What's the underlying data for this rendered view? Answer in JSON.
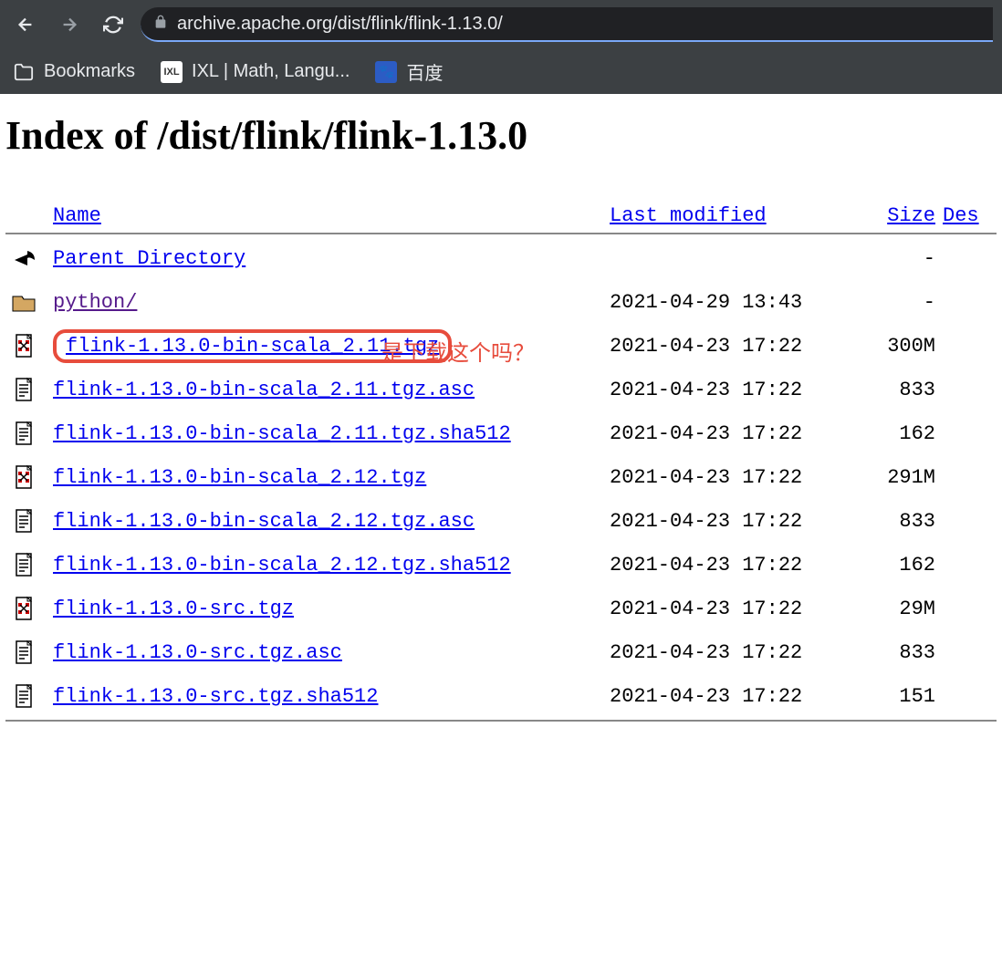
{
  "browser": {
    "url": "archive.apache.org/dist/flink/flink-1.13.0/",
    "bookmarks": {
      "folder": "Bookmarks",
      "ixl": "IXL | Math, Langu...",
      "baidu": "百度"
    }
  },
  "page": {
    "title": "Index of /dist/flink/flink-1.13.0",
    "annotation": "是下载这个吗？",
    "headers": {
      "name": "Name",
      "lastmod": "Last modified",
      "size": "Size",
      "desc": "Des"
    },
    "rows": [
      {
        "icon": "back",
        "name": "Parent Directory",
        "date": "",
        "size": "-",
        "visited": false,
        "highlight": false
      },
      {
        "icon": "folder",
        "name": "python/",
        "date": "2021-04-29 13:43",
        "size": "-",
        "visited": true,
        "highlight": false
      },
      {
        "icon": "archive",
        "name": "flink-1.13.0-bin-scala_2.11.tgz",
        "date": "2021-04-23 17:22",
        "size": "300M",
        "visited": false,
        "highlight": true
      },
      {
        "icon": "text",
        "name": "flink-1.13.0-bin-scala_2.11.tgz.asc",
        "date": "2021-04-23 17:22",
        "size": "833",
        "visited": false,
        "highlight": false
      },
      {
        "icon": "text",
        "name": "flink-1.13.0-bin-scala_2.11.tgz.sha512",
        "date": "2021-04-23 17:22",
        "size": "162",
        "visited": false,
        "highlight": false
      },
      {
        "icon": "archive",
        "name": "flink-1.13.0-bin-scala_2.12.tgz",
        "date": "2021-04-23 17:22",
        "size": "291M",
        "visited": false,
        "highlight": false
      },
      {
        "icon": "text",
        "name": "flink-1.13.0-bin-scala_2.12.tgz.asc",
        "date": "2021-04-23 17:22",
        "size": "833",
        "visited": false,
        "highlight": false
      },
      {
        "icon": "text",
        "name": "flink-1.13.0-bin-scala_2.12.tgz.sha512",
        "date": "2021-04-23 17:22",
        "size": "162",
        "visited": false,
        "highlight": false
      },
      {
        "icon": "archive",
        "name": "flink-1.13.0-src.tgz",
        "date": "2021-04-23 17:22",
        "size": " 29M",
        "visited": false,
        "highlight": false
      },
      {
        "icon": "text",
        "name": "flink-1.13.0-src.tgz.asc",
        "date": "2021-04-23 17:22",
        "size": "833",
        "visited": false,
        "highlight": false
      },
      {
        "icon": "text",
        "name": "flink-1.13.0-src.tgz.sha512",
        "date": "2021-04-23 17:22",
        "size": "151",
        "visited": false,
        "highlight": false
      }
    ]
  }
}
